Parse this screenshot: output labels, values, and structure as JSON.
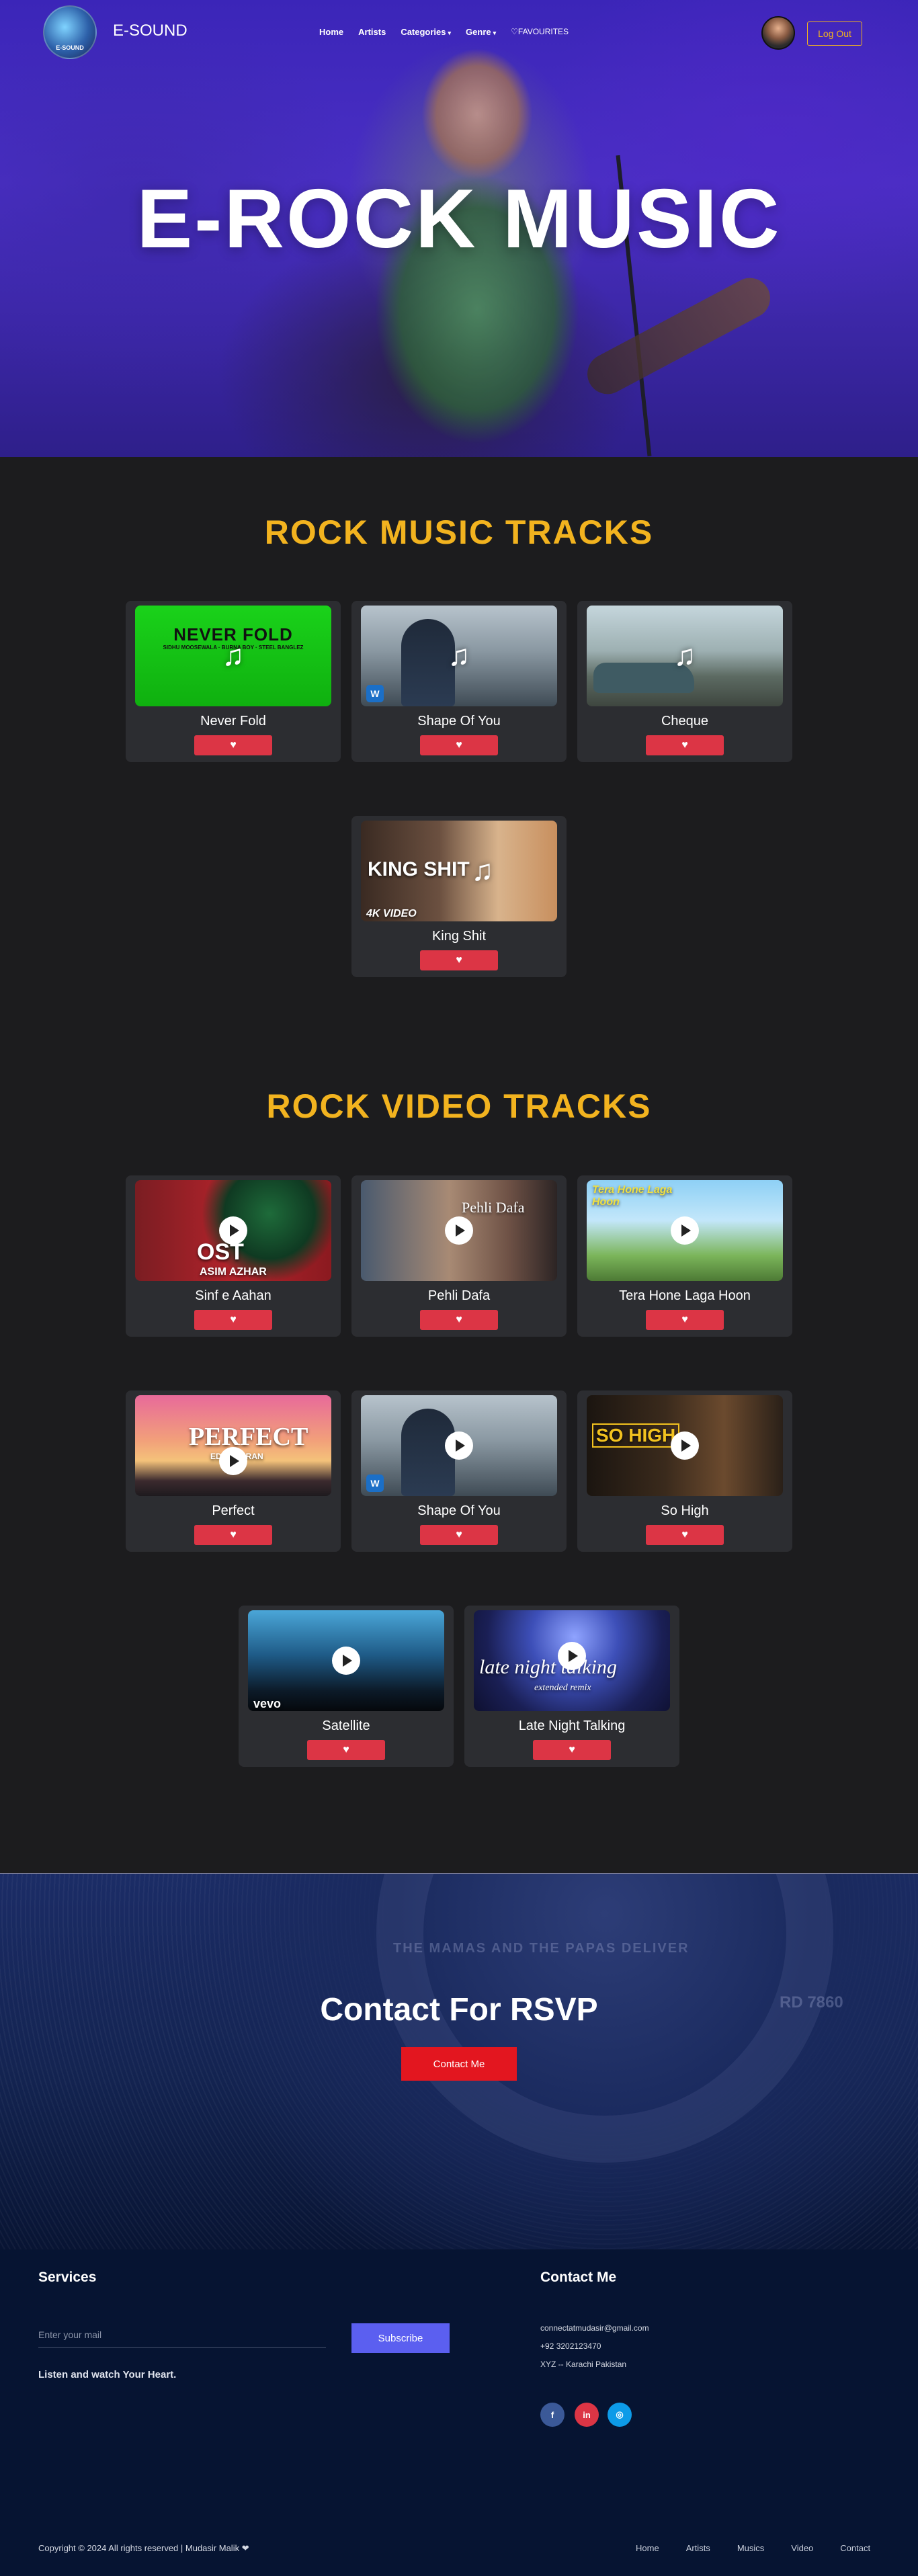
{
  "nav": {
    "logo_text": "E-SOUND",
    "brand": "E-SOUND",
    "links": [
      {
        "label": "Home"
      },
      {
        "label": "Artists"
      },
      {
        "label": "Categories",
        "dropdown": true
      },
      {
        "label": "Genre",
        "dropdown": true
      },
      {
        "label": "♡FAVOURITES"
      }
    ],
    "logout_label": "Log Out"
  },
  "hero": {
    "title": "E-ROCK MUSIC"
  },
  "music_section": {
    "title": "ROCK MUSIC TRACKS",
    "tracks": [
      {
        "name": "Never Fold",
        "thumb_text": "NEVER FOLD",
        "thumb_sub": "SIDHU MOOSEWALA · BURNA BOY · STEEL BANGLEZ"
      },
      {
        "name": "Shape Of You",
        "thumb_text": ""
      },
      {
        "name": "Cheque",
        "thumb_text": ""
      },
      {
        "name": "King Shit",
        "thumb_text": "KING SHIT",
        "thumb_sub": "4K VIDEO"
      }
    ]
  },
  "video_section": {
    "title": "ROCK VIDEO TRACKS",
    "tracks": [
      {
        "name": "Sinf e Aahan",
        "thumb_text": "OST",
        "thumb_sub": "ASIM AZHAR"
      },
      {
        "name": "Pehli Dafa",
        "thumb_text": "Pehli Dafa"
      },
      {
        "name": "Tera Hone Laga Hoon",
        "thumb_text": "Tera Hone Laga Hoon"
      },
      {
        "name": "Perfect",
        "thumb_text": "PERFECT",
        "thumb_sub": "ED SHEERAN"
      },
      {
        "name": "Shape Of You",
        "thumb_text": ""
      },
      {
        "name": "So High",
        "thumb_text": "SO HIGH"
      },
      {
        "name": "Satellite",
        "thumb_text": "vevo"
      },
      {
        "name": "Late Night Talking",
        "thumb_text": "late night talking",
        "thumb_sub": "extended remix"
      }
    ]
  },
  "rsvp": {
    "title": "Contact For RSVP",
    "button_label": "Contact Me",
    "deco_1": "THE MAMAS AND THE PAPAS DELIVER",
    "deco_2": "RD 7860"
  },
  "footer": {
    "services_heading": "Services",
    "email_placeholder": "Enter your mail",
    "subscribe_label": "Subscribe",
    "tagline": "Listen and watch Your Heart.",
    "contact_heading": "Contact Me",
    "contact_email": "connectatmudasir@gmail.com",
    "contact_phone": "+92 3202123470",
    "contact_address": "XYZ -- Karachi Pakistan",
    "social": [
      {
        "icon": "f",
        "color": "#3b5998"
      },
      {
        "icon": "in",
        "color": "#dc3545"
      },
      {
        "icon": "◎",
        "color": "#0d9be8"
      }
    ],
    "copyright": "Copyright © 2024 All rights reserved | Mudasir Malik ❤",
    "links": [
      {
        "label": "Home"
      },
      {
        "label": "Artists"
      },
      {
        "label": "Musics"
      },
      {
        "label": "Video"
      },
      {
        "label": "Contact"
      }
    ]
  },
  "colors": {
    "accent": "#f2b31f",
    "like_button": "#dc3545",
    "contact_button": "#e3161f",
    "subscribe_button": "#5b5ff0",
    "page_bg": "#1c1c1e",
    "card_bg": "#2c2d31"
  }
}
